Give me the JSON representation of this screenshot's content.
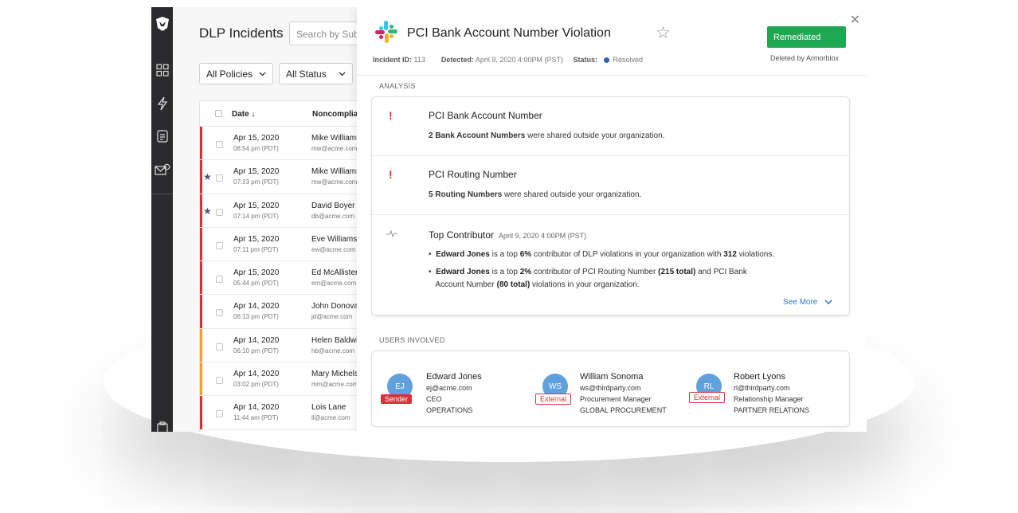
{
  "sidebar": {
    "icons": [
      "armorblox-logo-icon",
      "dashboard-grid-icon",
      "lightning-icon",
      "document-icon",
      "mail-icon",
      "clipboard-icon"
    ]
  },
  "list": {
    "title": "DLP Incidents",
    "search_placeholder": "Search by Subject",
    "filters": [
      {
        "label": "All Policies"
      },
      {
        "label": "All Status"
      }
    ],
    "columns": {
      "date": "Date ↓",
      "noncompliance": "Noncomplia"
    },
    "rows": [
      {
        "date": "Apr 15, 2020",
        "time": "08:54 pm (PDT)",
        "name": "Mike Williams",
        "email": "mw@acme.com",
        "starred": false,
        "severity_color": "#d9333a"
      },
      {
        "date": "Apr 15, 2020",
        "time": "07:23 pm (PDT)",
        "name": "Mike Williams",
        "email": "mw@acme.com",
        "starred": true,
        "severity_color": "#d9333a"
      },
      {
        "date": "Apr 15, 2020",
        "time": "07:14 pm (PDT)",
        "name": "David Boyer",
        "email": "db@acme.com",
        "starred": true,
        "severity_color": "#d9333a"
      },
      {
        "date": "Apr 15, 2020",
        "time": "07:11 pm (PDT)",
        "name": "Eve Williams",
        "email": "ew@acme.com",
        "starred": false,
        "severity_color": "#d9333a"
      },
      {
        "date": "Apr 15, 2020",
        "time": "05:44 pm (PDT)",
        "name": "Ed McAllister",
        "email": "em@acme.com",
        "starred": false,
        "severity_color": "#d9333a"
      },
      {
        "date": "Apr 14, 2020",
        "time": "06:13 pm (PDT)",
        "name": "John Donovan",
        "email": "jd@acme.com",
        "starred": false,
        "severity_color": "#d9333a"
      },
      {
        "date": "Apr 14, 2020",
        "time": "06:10 pm (PDT)",
        "name": "Helen Baldwin",
        "email": "hb@acme.com",
        "starred": false,
        "severity_color": "#f0a030"
      },
      {
        "date": "Apr 14, 2020",
        "time": "03:02 pm (PDT)",
        "name": "Mary Michelson",
        "email": "mm@acme.com",
        "starred": false,
        "severity_color": "#f0a030"
      },
      {
        "date": "Apr 14, 2020",
        "time": "11:44 am (PDT)",
        "name": "Lois Lane",
        "email": "ll@acme.com",
        "starred": false,
        "severity_color": "#d9333a"
      }
    ]
  },
  "detail": {
    "title": "PCI Bank Account Number Violation",
    "remediated_label": "Remediated",
    "deleted_by": "Deleted by Armorblox",
    "incident_id_label": "Incident ID:",
    "incident_id": "113",
    "detected_label": "Detected:",
    "detected": "April 9, 2020 4:00PM (PST)",
    "status_label": "Status:",
    "status": "Resolved",
    "status_color": "#2d64b1",
    "analysis_label": "ANALYSIS",
    "findings": [
      {
        "title": "PCI Bank Account Number",
        "bold": "2 Bank Account Numbers",
        "rest": " were shared outside your organization."
      },
      {
        "title": "PCI Routing Number",
        "bold": "5 Routing Numbers",
        "rest": " were shared outside your organization."
      }
    ],
    "top_contributor": {
      "title": "Top Contributor",
      "date": "April 9, 2020 4:00PM (PST)",
      "b1": {
        "name": "Edward Jones",
        "t1": " is a top ",
        "pct": "6%",
        "t2": " contributor of DLP violations in your organization with ",
        "count": "312",
        "t3": " violations."
      },
      "b2": {
        "name": "Edward Jones",
        "t1": " is a top ",
        "pct": "2%",
        "t2": " contributor of PCI Routing Number ",
        "total1": "(215 total)",
        "t3": " and PCI Bank",
        "t4": "Account Number ",
        "total2": "(80 total)",
        "t5": " violations in your organization."
      }
    },
    "see_more": "See More",
    "users_label": "USERS INVOLVED",
    "users": [
      {
        "initials": "EJ",
        "tag": "Sender",
        "name": "Edward Jones",
        "email": "ej@acme.com",
        "role": "CEO",
        "dept": "OPERATIONS"
      },
      {
        "initials": "WS",
        "tag": "External",
        "name": "William Sonoma",
        "email": "ws@thirdparty.com",
        "role": "Procurement Manager",
        "dept": "GLOBAL PROCUREMENT"
      },
      {
        "initials": "RL",
        "tag": "External",
        "name": "Robert Lyons",
        "email": "rl@thirdparty.com",
        "role": "Relationship Manager",
        "dept": "PARTNER RELATIONS"
      }
    ]
  }
}
